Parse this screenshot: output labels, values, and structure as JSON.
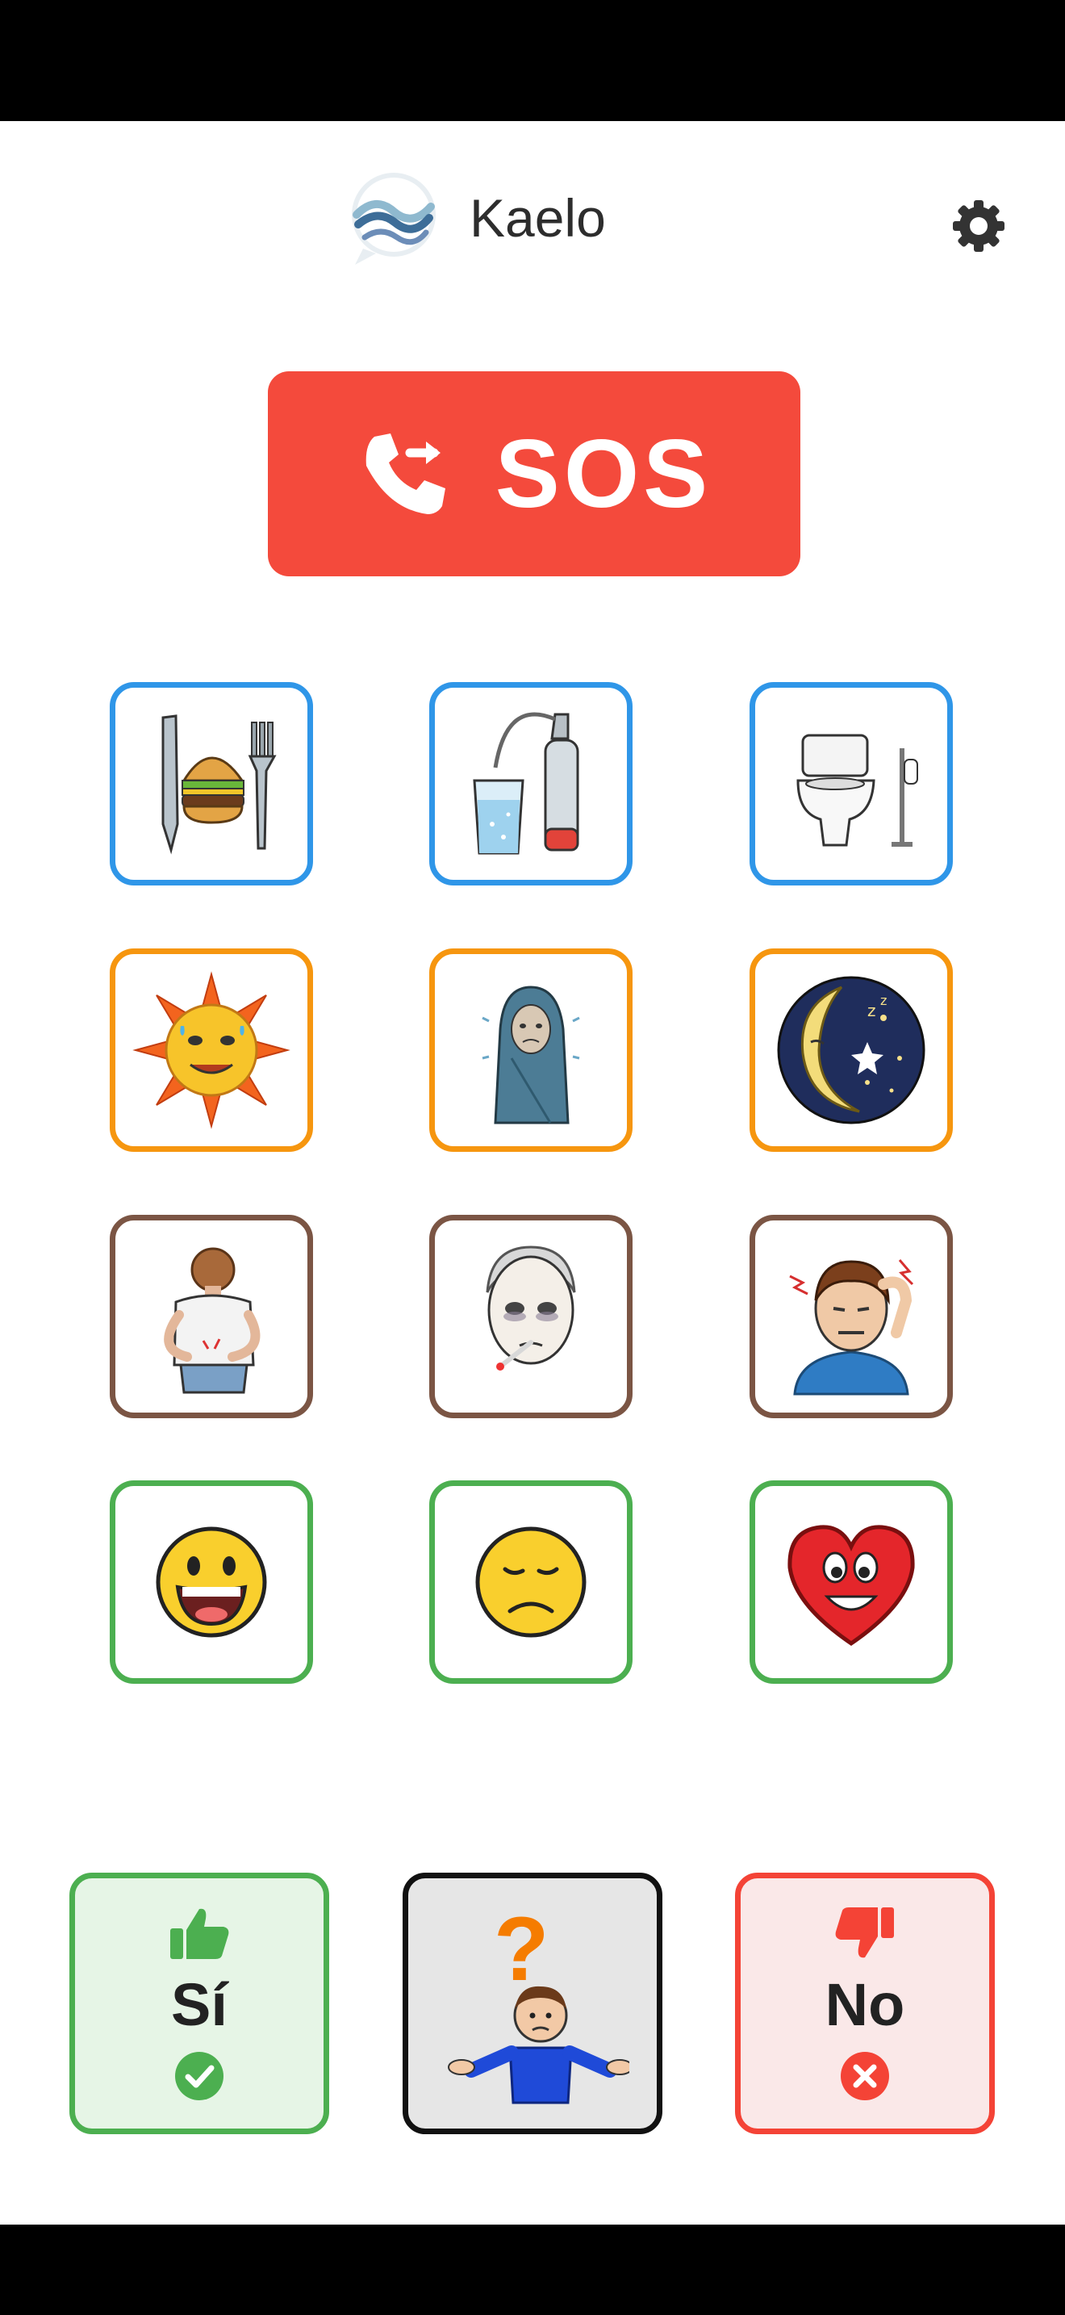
{
  "app": {
    "title": "Kaelo"
  },
  "icons": {
    "logo": "kaelo-logo",
    "settings": "gear-icon",
    "sos": "phone-forward-icon",
    "yes_thumb": "thumbs-up-icon",
    "yes_check": "check-circle-icon",
    "no_thumb": "thumbs-down-icon",
    "no_cross": "x-circle-icon"
  },
  "sos": {
    "label": "SOS"
  },
  "grid": [
    {
      "icon": "food-icon",
      "group": "needs"
    },
    {
      "icon": "water-icon",
      "group": "needs"
    },
    {
      "icon": "toilet-icon",
      "group": "needs"
    },
    {
      "icon": "hot-sun-icon",
      "group": "temperature"
    },
    {
      "icon": "cold-blanket-icon",
      "group": "temperature"
    },
    {
      "icon": "sleep-moon-icon",
      "group": "temperature"
    },
    {
      "icon": "back-pain-icon",
      "group": "symptoms"
    },
    {
      "icon": "fever-icon",
      "group": "symptoms"
    },
    {
      "icon": "headache-icon",
      "group": "symptoms"
    },
    {
      "icon": "happy-face-icon",
      "group": "emotions"
    },
    {
      "icon": "sad-face-icon",
      "group": "emotions"
    },
    {
      "icon": "love-heart-icon",
      "group": "emotions"
    }
  ],
  "answers": {
    "yes": {
      "label": "Sí"
    },
    "unknown": {
      "label": "",
      "icon": "question-person-icon"
    },
    "no": {
      "label": "No"
    }
  },
  "colors": {
    "sos": "#f44a3c",
    "needs": "#2f96e8",
    "temperature": "#f6960f",
    "symptoms": "#7b5544",
    "emotions": "#4caf50",
    "yes": "#4caf50",
    "no": "#f44336",
    "unknown_accent": "#f57c00"
  }
}
